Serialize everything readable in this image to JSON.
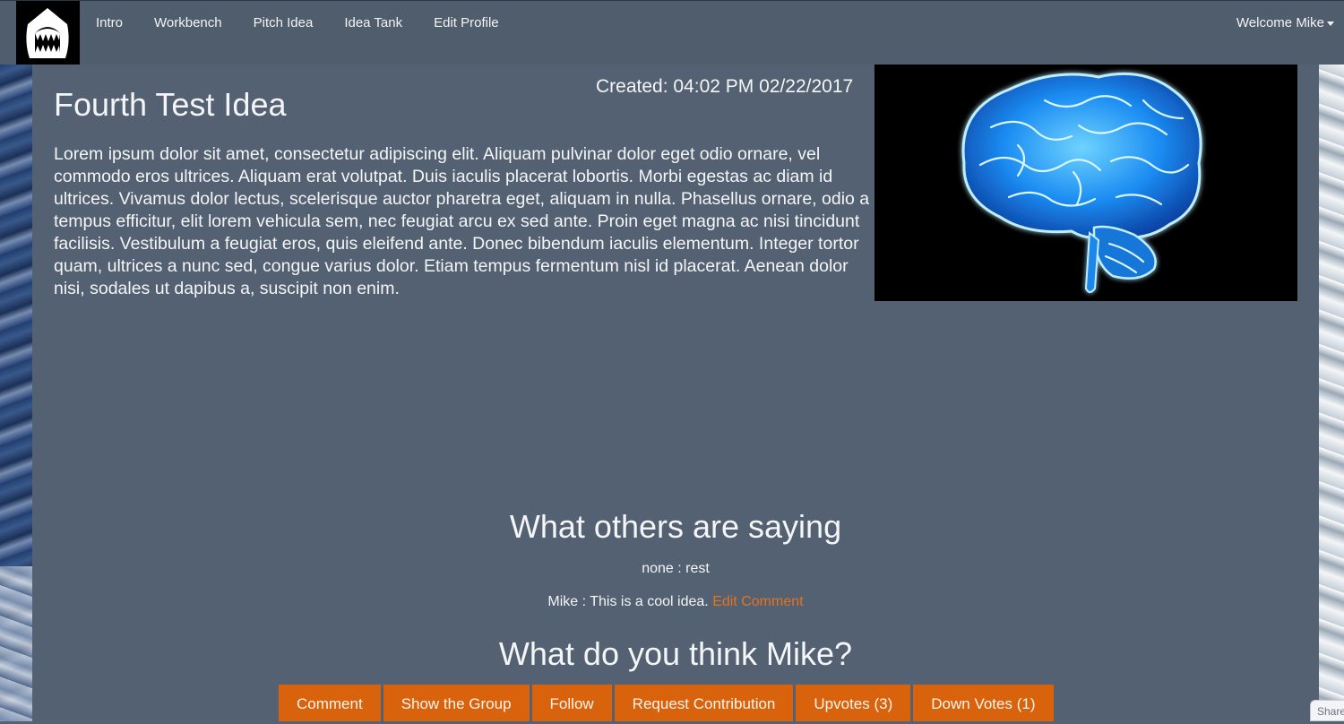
{
  "nav": {
    "links": [
      "Intro",
      "Workbench",
      "Pitch Idea",
      "Idea Tank",
      "Edit Profile"
    ],
    "welcome": "Welcome Mike"
  },
  "idea": {
    "title": "Fourth Test Idea",
    "created": "Created: 04:02 PM 02/22/2017",
    "body": "Lorem ipsum dolor sit amet, consectetur adipiscing elit. Aliquam pulvinar dolor eget odio ornare, vel commodo eros ultrices. Aliquam erat volutpat. Duis iaculis placerat lobortis. Morbi egestas ac diam id ultrices. Vivamus dolor lectus, scelerisque auctor pharetra eget, aliquam in nulla. Phasellus ornare, odio a tempus efficitur, elit lorem vehicula sem, nec feugiat arcu ex sed ante. Proin eget magna ac nisi tincidunt facilisis. Vestibulum a feugiat eros, quis eleifend ante. Donec bibendum iaculis elementum. Integer tortor quam, ultrices a nunc sed, congue varius dolor. Etiam tempus fermentum nisl id placerat. Aenean dolor nisi, sodales ut dapibus a, suscipit non enim.",
    "image_icon": "brain-image"
  },
  "comments": {
    "heading": "What others are saying",
    "items": [
      {
        "text": "none : rest"
      },
      {
        "text": "Mike : This is a cool idea.",
        "edit_label": "Edit Comment"
      }
    ]
  },
  "prompt": {
    "heading": "What do you think Mike?"
  },
  "actions": {
    "comment": "Comment",
    "show_group": "Show the Group",
    "follow": "Follow",
    "request_contribution": "Request Contribution",
    "upvotes": "Upvotes (3)",
    "downvotes": "Down Votes (1)"
  },
  "share_tab": "Share",
  "colors": {
    "navbar": "#4f5d6d",
    "panel": "#546172",
    "accent": "#d9620d",
    "link": "#e3731d",
    "text": "#f4f5f7"
  }
}
